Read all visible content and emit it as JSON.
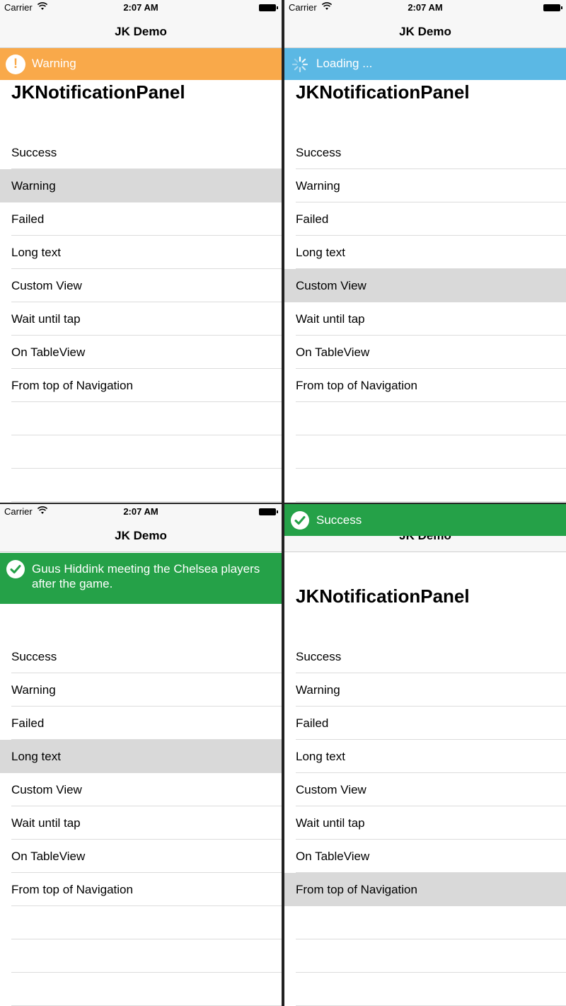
{
  "status_bar": {
    "carrier": "Carrier",
    "time": "2:07 AM"
  },
  "nav_title": "JK Demo",
  "page_title": "JKNotificationPanel",
  "menu": [
    "Success",
    "Warning",
    "Failed",
    "Long text",
    "Custom View",
    "Wait until tap",
    "On TableView",
    "From top of Navigation"
  ],
  "screens": [
    {
      "panel": {
        "type": "warning",
        "text": "Warning",
        "color": "#f9a94a",
        "icon": "exclamation-icon"
      },
      "selected": "Warning"
    },
    {
      "panel": {
        "type": "loading",
        "text": "Loading ...",
        "color": "#5bb8e4",
        "icon": "spinner-icon"
      },
      "selected": "Custom View"
    },
    {
      "panel": {
        "type": "success",
        "text": "Guus Hiddink meeting the Chelsea players after the game.",
        "color": "#25a148",
        "icon": "checkmark-icon"
      },
      "selected": "Long text"
    },
    {
      "panel": {
        "type": "success",
        "text": "Success",
        "color": "#25a148",
        "icon": "checkmark-icon"
      },
      "selected": "From top of Navigation"
    }
  ],
  "colors": {
    "selected_row": "#d9d9d9",
    "separator": "#dcdcdc",
    "navbar": "#f7f7f7"
  }
}
